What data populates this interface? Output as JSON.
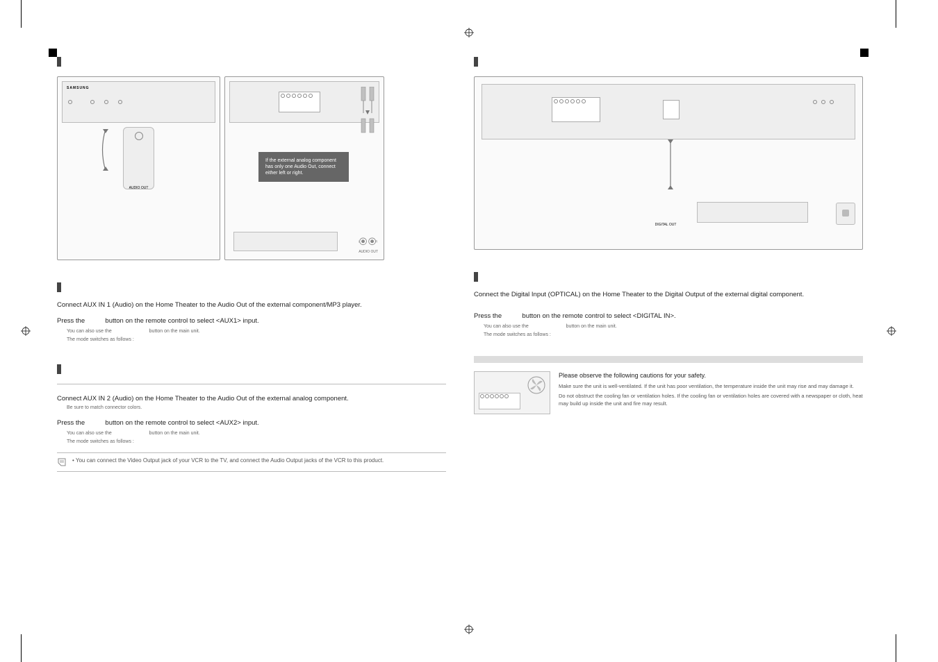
{
  "left_figures": {
    "brand_label": "SAMSUNG",
    "mp3_port_label": "AUDIO OUT",
    "speech_bubble": "If the external analog component has only one Audio Out, connect either left or right.",
    "amp_port_label": "AUDIO OUT"
  },
  "right_figure": {
    "digital_port_label": "DIGITAL OUT"
  },
  "aux1": {
    "step1": "Connect AUX IN 1 (Audio) on the Home Theater to the Audio Out of the external component/MP3 player.",
    "step2_a": "Press the",
    "step2_b": "button on the remote control to select <AUX1> input.",
    "sub_a": "You can also use the",
    "sub_b": "button on the main unit.",
    "sub2": "The mode switches as follows :"
  },
  "aux2": {
    "step1": "Connect AUX IN 2 (Audio) on the Home Theater to the Audio Out of the external analog component.",
    "sub_colors": "Be sure to match connector colors.",
    "step2_a": "Press the",
    "step2_b": "button on the remote control to select <AUX2> input.",
    "sub_a": "You can also use the",
    "sub_b": "button on the main unit.",
    "sub2": "The mode switches as follows :"
  },
  "note": {
    "bullet": "• You can connect the Video Output jack of your VCR to the TV, and connect the Audio Output jacks of the VCR to this product."
  },
  "optical": {
    "step1": "Connect the Digital Input (OPTICAL) on the Home Theater to the Digital Output of the external digital component.",
    "step2_a": "Press the",
    "step2_b": "button on the remote control to select <DIGITAL IN>.",
    "sub_a": "You can also use the",
    "sub_b": "button on the main unit.",
    "sub2": "The mode switches as follows :"
  },
  "fan": {
    "caption": "Please observe the following cautions for your safety.",
    "line1": "Make sure the unit is well-ventilated. If the unit has poor ventilation, the temperature inside the unit may rise and may damage it.",
    "line2": "Do not obstruct the cooling fan or ventilation holes. If the cooling fan or ventilation holes are covered with a newspaper or cloth, heat may build up inside the unit and fire may result."
  }
}
